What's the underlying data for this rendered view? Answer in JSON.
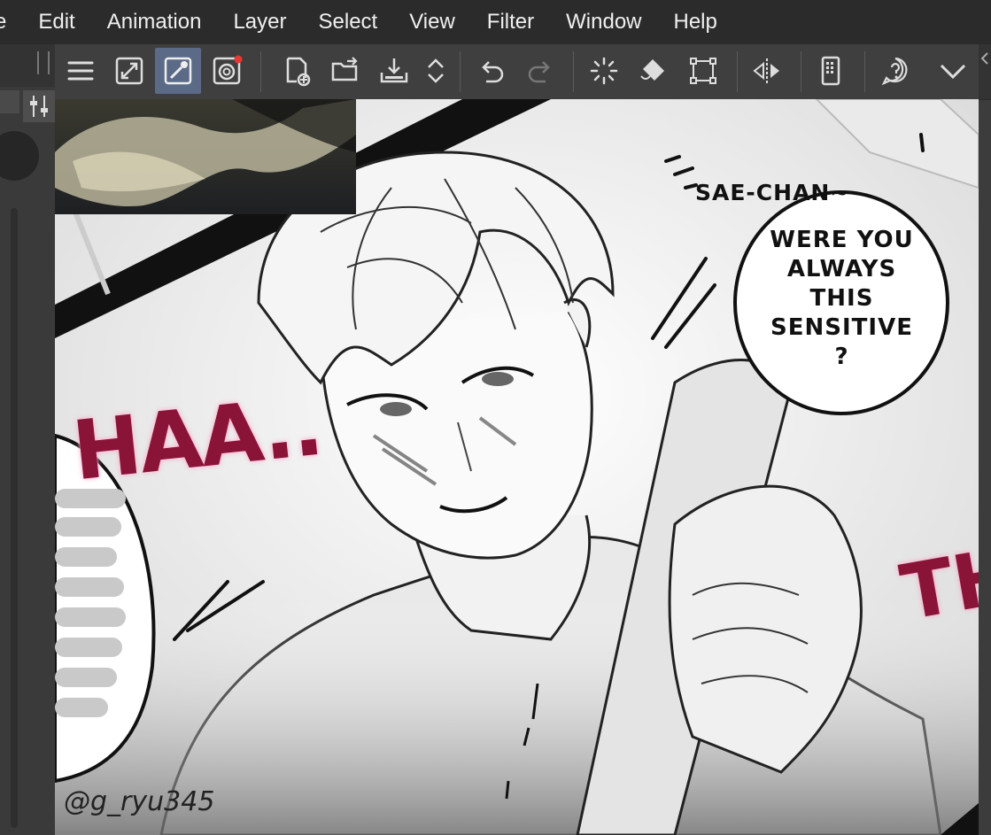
{
  "menu": {
    "items": [
      "e",
      "Edit",
      "Animation",
      "Layer",
      "Select",
      "View",
      "Filter",
      "Window",
      "Help"
    ]
  },
  "toolbar": {
    "buttons": [
      {
        "icon": "hamburger-menu-icon"
      },
      {
        "icon": "fit-canvas-icon"
      },
      {
        "icon": "eyedropper-icon",
        "active": true
      },
      {
        "icon": "companion-icon",
        "badge_color": "#e53935"
      },
      {
        "icon": "new-file-icon"
      },
      {
        "icon": "open-folder-icon"
      },
      {
        "icon": "save-icon"
      },
      {
        "icon": "scroll-arrows-icon"
      },
      {
        "icon": "undo-icon"
      },
      {
        "icon": "redo-icon"
      },
      {
        "icon": "loading-spinner-icon"
      },
      {
        "icon": "fill-bucket-icon"
      },
      {
        "icon": "transform-icon"
      },
      {
        "icon": "flip-horizontal-icon"
      },
      {
        "icon": "device-icon"
      },
      {
        "icon": "help-icon"
      },
      {
        "icon": "chevron-down-icon"
      }
    ]
  },
  "canvas": {
    "caption": "SAE-CHAN~",
    "bubble_lines": [
      "WERE YOU",
      "ALWAYS",
      "THIS",
      "SENSITIVE",
      "?"
    ],
    "sfx_left": "HAA..",
    "sfx_right": "TH",
    "signature": "@g_ryu345"
  },
  "colors": {
    "menubar_bg": "#2b2b2b",
    "toolbar_bg": "#3f3f3f",
    "active_tool": "#5b6a86",
    "sfx": "#8a1438"
  }
}
